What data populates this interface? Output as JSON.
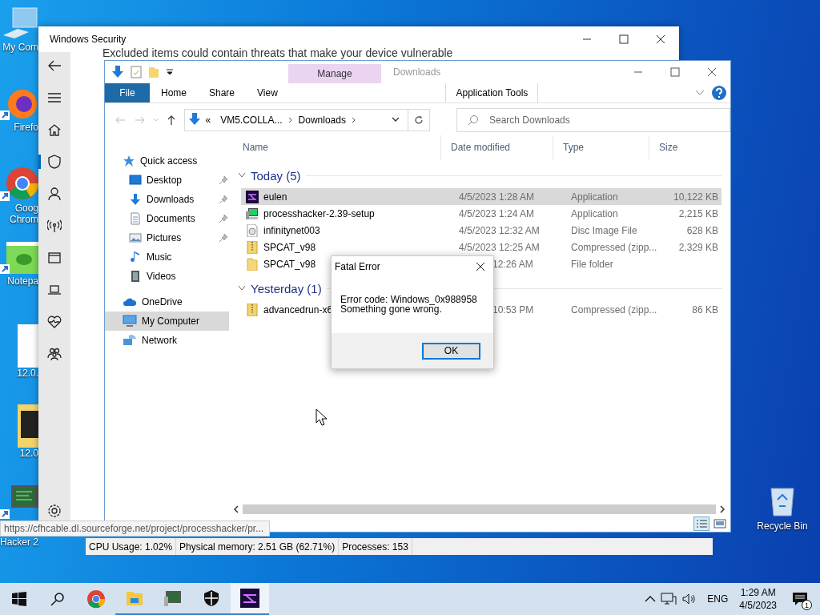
{
  "desktop_icons": [
    {
      "kind": "computer",
      "label": "My Com"
    },
    {
      "kind": "firefox",
      "label": "Firefo"
    },
    {
      "kind": "chrome",
      "label": "Goog",
      "label_2": "Chrom"
    },
    {
      "kind": "notepad",
      "label": "Notepa"
    },
    {
      "kind": "file",
      "label": "12.0."
    },
    {
      "kind": "folder",
      "label": "12.0"
    },
    {
      "kind": "hacker",
      "label": "Hacker 2"
    }
  ],
  "recycle_bin": {
    "label": "Recycle Bin"
  },
  "security_window": {
    "title": "Windows Security",
    "notice": "Excluded items could contain threats that make your device vulnerable",
    "nav": [
      {
        "kind": "home",
        "selected": false
      },
      {
        "kind": "shield",
        "selected": true
      },
      {
        "kind": "person",
        "selected": false
      },
      {
        "kind": "wifi",
        "selected": false
      },
      {
        "kind": "window",
        "selected": false
      },
      {
        "kind": "laptop",
        "selected": false
      },
      {
        "kind": "heart",
        "selected": false
      },
      {
        "kind": "family",
        "selected": false
      }
    ]
  },
  "process_hacker": {
    "tooltip": "https://cfhcable.dl.sourceforge.net/project/processhacker/pr...",
    "status": [
      "CPU Usage: 1.02%",
      "Physical memory: 2.51 GB (62.71%)",
      "Processes: 153"
    ]
  },
  "explorer": {
    "title": "Downloads",
    "context_tab": "Manage",
    "ribbon_tabs": [
      {
        "label": "File",
        "kind": "file"
      },
      {
        "label": "Home",
        "kind": "tab"
      },
      {
        "label": "Share",
        "kind": "tab"
      },
      {
        "label": "View",
        "kind": "tab"
      },
      {
        "label": "Application Tools",
        "kind": "context"
      }
    ],
    "path_overflow": "«",
    "path": [
      "VM5.COLLA...",
      "Downloads"
    ],
    "search": {
      "placeholder": "Search Downloads"
    },
    "nav": [
      {
        "label": "Quick access",
        "kind": "star",
        "selected": false,
        "children": [
          {
            "label": "Desktop",
            "kind": "desktop",
            "pinned": true,
            "selected": false
          },
          {
            "label": "Downloads",
            "kind": "download",
            "pinned": true,
            "selected": false
          },
          {
            "label": "Documents",
            "kind": "documents",
            "pinned": true,
            "selected": false
          },
          {
            "label": "Pictures",
            "kind": "pictures",
            "pinned": true,
            "selected": false
          },
          {
            "label": "Music",
            "kind": "music",
            "pinned": false,
            "selected": false
          },
          {
            "label": "Videos",
            "kind": "videos",
            "pinned": false,
            "selected": false
          }
        ]
      },
      {
        "label": "OneDrive",
        "kind": "cloud",
        "selected": false
      },
      {
        "label": "My Computer",
        "kind": "computer",
        "selected": true
      },
      {
        "label": "Network",
        "kind": "network",
        "selected": false
      }
    ],
    "columns": [
      "Name",
      "Date modified",
      "Type",
      "Size"
    ],
    "groups": [
      {
        "label": "Today (5)",
        "rows": [
          {
            "kind": "app",
            "name": "eulen",
            "date": "4/5/2023 1:28 AM",
            "type": "Application",
            "size": "10,122 KB",
            "selected": true,
            "covered": false
          },
          {
            "kind": "hacker",
            "name": "processhacker-2.39-setup",
            "date": "4/5/2023 1:24 AM",
            "type": "Application",
            "size": "2,215 KB",
            "selected": false,
            "covered": false
          },
          {
            "kind": "disc",
            "name": "infinitynet003",
            "date": "4/5/2023 12:32 AM",
            "type": "Disc Image File",
            "size": "628 KB",
            "selected": false,
            "covered": false
          },
          {
            "kind": "zip",
            "name": "SPCAT_v98",
            "date": "4/5/2023 12:25 AM",
            "type": "Compressed (zipp...",
            "size": "2,329 KB",
            "selected": false,
            "covered": false
          },
          {
            "kind": "folder",
            "name": "SPCAT_v98",
            "date": "12:26 AM",
            "type": "File folder",
            "selected": false,
            "covered": true
          }
        ]
      },
      {
        "label": "Yesterday (1)",
        "rows": [
          {
            "kind": "zip",
            "name": "advancedrun-x6",
            "date": "10:53 PM",
            "type": "Compressed (zipp...",
            "size": "86 KB",
            "selected": false,
            "covered": true
          }
        ]
      }
    ]
  },
  "dialog": {
    "title": "Fatal Error",
    "lines": [
      "Error code: Windows_0x988958",
      "Something gone wrong."
    ],
    "button": "OK"
  },
  "taskbar": {
    "apps": [
      {
        "kind": "chrome",
        "running": false,
        "active": false
      },
      {
        "kind": "explorer",
        "running": true,
        "active": false
      },
      {
        "kind": "hacker",
        "running": true,
        "active": false
      },
      {
        "kind": "shield",
        "running": true,
        "active": false
      },
      {
        "kind": "app",
        "running": true,
        "active": true
      }
    ],
    "language": "ENG",
    "time": "1:29 AM",
    "date": "4/5/2023",
    "notifications": "1"
  }
}
